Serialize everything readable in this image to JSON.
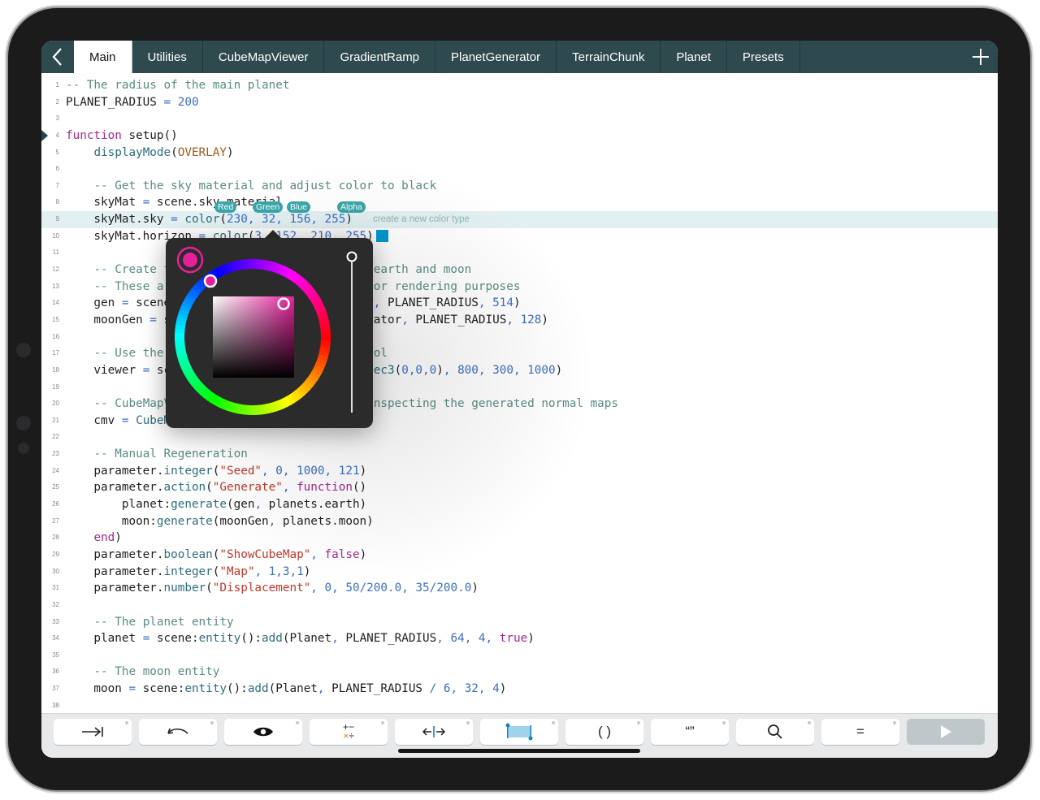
{
  "tabs": {
    "active": "Main",
    "items": [
      "Main",
      "Utilities",
      "CubeMapViewer",
      "GradientRamp",
      "PlanetGenerator",
      "TerrainChunk",
      "Planet",
      "Presets"
    ]
  },
  "icons": {
    "back": "chevron-left-icon",
    "add": "plus-icon"
  },
  "editor": {
    "selected_line": 9,
    "color_hint": "create a new color type",
    "chips": [
      "Red",
      "Green",
      "Blue",
      "Alpha"
    ],
    "lines": [
      {
        "n": "1",
        "t": "-- The radius of the main planet"
      },
      {
        "n": "2",
        "t": "PLANET_RADIUS = 200"
      },
      {
        "n": "3",
        "t": ""
      },
      {
        "n": "4",
        "t": "function setup()"
      },
      {
        "n": "5",
        "t": "    displayMode(OVERLAY)"
      },
      {
        "n": "6",
        "t": ""
      },
      {
        "n": "7",
        "t": "    -- Get the sky material and adjust color to black"
      },
      {
        "n": "8",
        "t": "    skyMat = scene.sky.material"
      },
      {
        "n": "9",
        "t": "    skyMat.sky = color(230, 32, 156, 255)"
      },
      {
        "n": "10",
        "t": "    skyMat.horizon = color(3, 152, 210, 255)"
      },
      {
        "n": "11",
        "t": ""
      },
      {
        "n": "12",
        "t": "    -- Create the planet generators for the earth and moon"
      },
      {
        "n": "13",
        "t": "    -- These are used to generate the maps for rendering purposes"
      },
      {
        "n": "14",
        "t": "    gen = scene:entity():add(PlanetGenerator, PLANET_RADIUS, 514)"
      },
      {
        "n": "15",
        "t": "    moonGen = scene:entity():add(PlanetGenerator, PLANET_RADIUS, 128)"
      },
      {
        "n": "16",
        "t": ""
      },
      {
        "n": "17",
        "t": "    -- Use the orbit viewer for camera control"
      },
      {
        "n": "18",
        "t": "    viewer = scene.camera:add(OrbitViewer, vec3(0,0,0), 800, 300, 1000)"
      },
      {
        "n": "19",
        "t": ""
      },
      {
        "n": "20",
        "t": "    -- CubeMapViewer is a helpful tool for inspecting the generated normal maps"
      },
      {
        "n": "21",
        "t": "    cmv = CubeMapViewer()"
      },
      {
        "n": "22",
        "t": ""
      },
      {
        "n": "23",
        "t": "    -- Manual Regeneration"
      },
      {
        "n": "24",
        "t": "    parameter.integer(\"Seed\", 0, 1000, 121)"
      },
      {
        "n": "25",
        "t": "    parameter.action(\"Generate\", function()"
      },
      {
        "n": "26",
        "t": "        planet:generate(gen, planets.earth)"
      },
      {
        "n": "27",
        "t": "        moon:generate(moonGen, planets.moon)"
      },
      {
        "n": "28",
        "t": "    end)"
      },
      {
        "n": "29",
        "t": "    parameter.boolean(\"ShowCubeMap\", false)"
      },
      {
        "n": "30",
        "t": "    parameter.integer(\"Map\", 1,3,1)"
      },
      {
        "n": "31",
        "t": "    parameter.number(\"Displacement\", 0, 50/200.0, 35/200.0)"
      },
      {
        "n": "32",
        "t": ""
      },
      {
        "n": "33",
        "t": "    -- The planet entity"
      },
      {
        "n": "34",
        "t": "    planet = scene:entity():add(Planet, PLANET_RADIUS, 64, 4, true)"
      },
      {
        "n": "35",
        "t": ""
      },
      {
        "n": "36",
        "t": "    -- The moon entity"
      },
      {
        "n": "37",
        "t": "    moon = scene:entity():add(Planet, PLANET_RADIUS / 6, 32, 4)"
      },
      {
        "n": "38",
        "t": ""
      }
    ]
  },
  "color_picker": {
    "red": 230,
    "green": 32,
    "blue": 156,
    "alpha": 255,
    "current_color": "#e6209c",
    "horizon_color": "#0398d2"
  },
  "toolbar": {
    "buttons": [
      {
        "name": "indent-button",
        "glyph": "⇥"
      },
      {
        "name": "undo-button",
        "glyph": "⤺"
      },
      {
        "name": "eye-button",
        "glyph": "eye-icon"
      },
      {
        "name": "math-operators-button",
        "glyph": "+−×÷"
      },
      {
        "name": "cursor-move-button",
        "glyph": "←|→"
      },
      {
        "name": "selection-button",
        "glyph": "selection-icon"
      },
      {
        "name": "parentheses-button",
        "glyph": "( )"
      },
      {
        "name": "quotes-button",
        "glyph": "“”"
      },
      {
        "name": "search-button",
        "glyph": "search-icon"
      },
      {
        "name": "equals-button",
        "glyph": "="
      },
      {
        "name": "run-button",
        "glyph": "play-icon"
      }
    ]
  }
}
